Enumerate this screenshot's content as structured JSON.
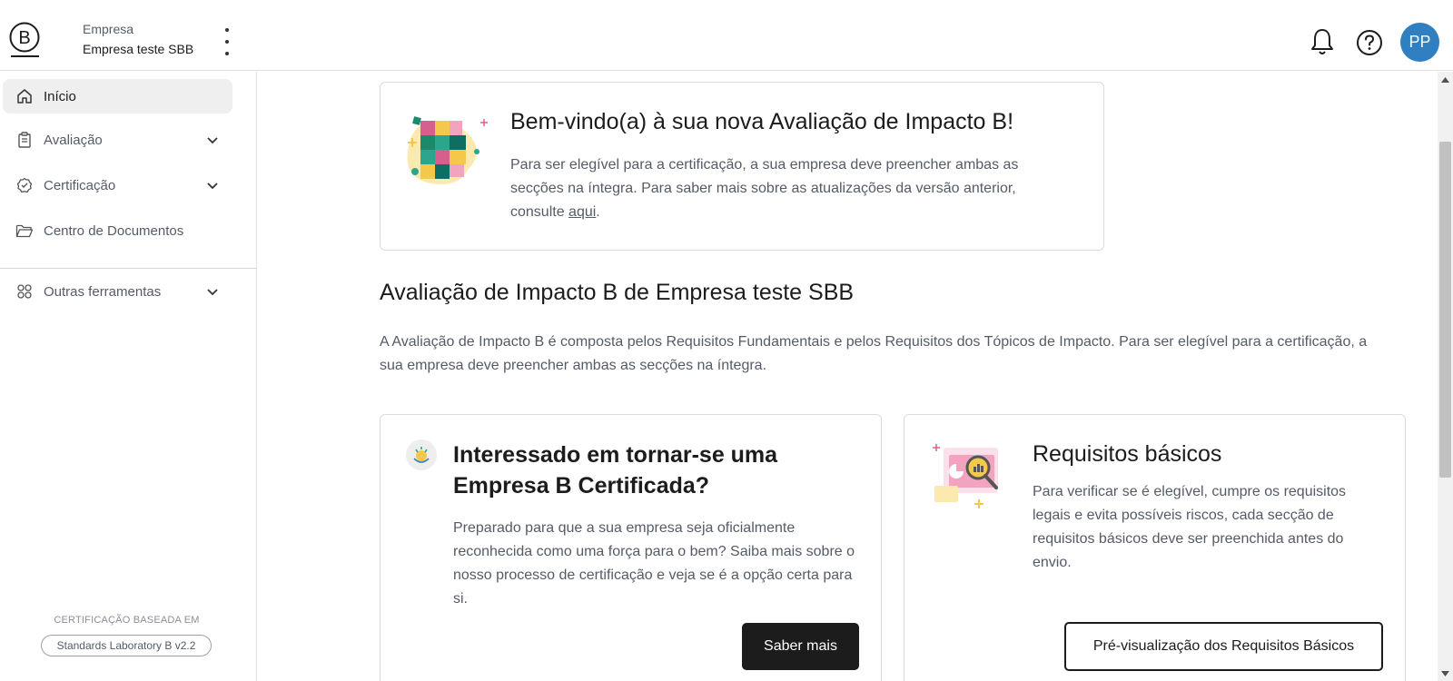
{
  "header": {
    "company_label": "Empresa",
    "company_name": "Empresa teste SBB",
    "avatar_initials": "PP",
    "avatar_color": "#2f7fc1",
    "icons": [
      "b-corp-logo",
      "kebab-menu-icon",
      "bell-icon",
      "help-icon"
    ]
  },
  "sidebar": {
    "items": [
      {
        "label": "Início",
        "icon": "home-icon",
        "active": true
      },
      {
        "label": "Avaliação",
        "icon": "clipboard-icon",
        "expandable": true
      },
      {
        "label": "Certificação",
        "icon": "badge-check-icon",
        "expandable": true
      },
      {
        "label": "Centro de Documentos",
        "icon": "folder-icon"
      },
      {
        "label": "Outras ferramentas",
        "icon": "grid-icon",
        "expandable": true
      }
    ],
    "certification_label": "CERTIFICAÇÃO BASEADA EM",
    "standard_version": "Standards Laboratory B v2.2"
  },
  "welcome": {
    "title": "Bem-vindo(a) à sua nova Avaliação de Impacto B!",
    "text_before_link": "Para ser elegível para a certificação, a sua empresa deve preencher ambas as secções na íntegra. Para saber mais sobre as atualizações da versão anterior, consulte ",
    "link_text": "aqui",
    "text_after_link": "."
  },
  "assessment": {
    "title": "Avaliação de Impacto B de Empresa teste SBB",
    "description": "A Avaliação de Impacto B é composta pelos Requisitos Fundamentais e pelos Requisitos dos Tópicos de Impacto. Para ser elegível para a certificação, a sua empresa deve preencher ambas as secções na íntegra."
  },
  "cards": {
    "certified": {
      "title": "Interessado em tornar-se uma Empresa B Certificada?",
      "text": "Preparado para que a sua empresa seja oficialmente reconhecida como uma força para o bem? Saiba mais sobre o nosso processo de certificação e veja se é a opção certa para si.",
      "button": "Saber mais"
    },
    "basic": {
      "title": "Requisitos básicos",
      "text": "Para verificar se é elegível, cumpre os requisitos legais e evita possíveis riscos, cada secção de requisitos básicos deve ser preenchida antes do envio.",
      "button": "Pré-visualização dos Requisitos Básicos"
    }
  }
}
